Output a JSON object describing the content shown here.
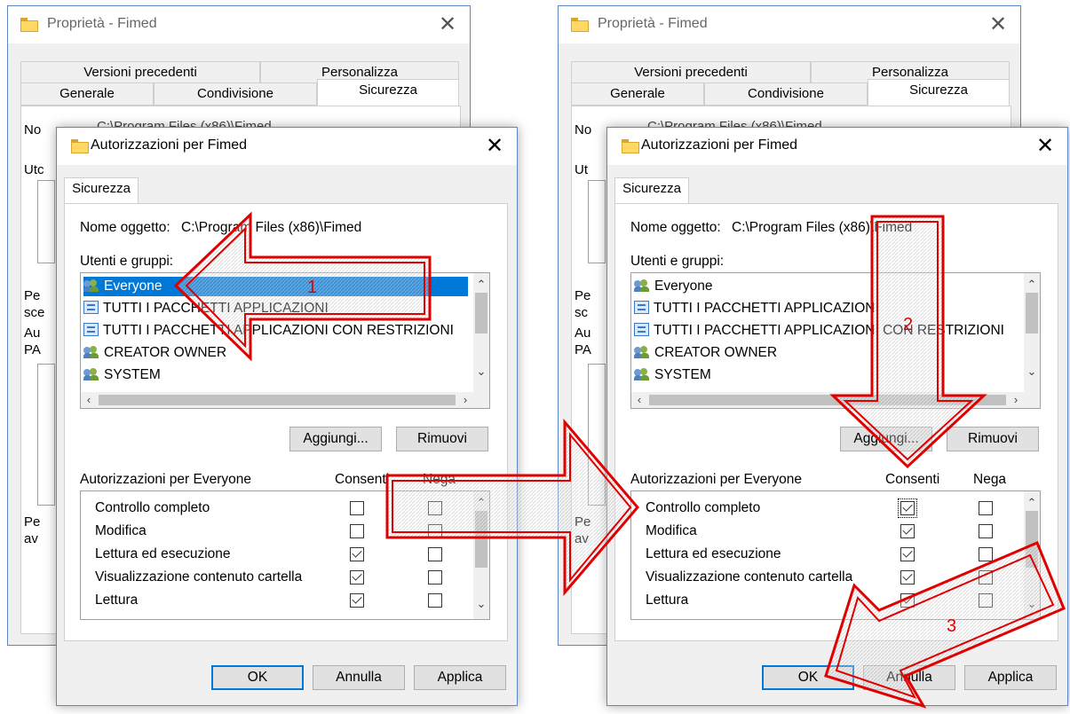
{
  "properties": {
    "title": "Proprietà - Fimed",
    "tabs_row1": [
      "Versioni precedenti",
      "Personalizza"
    ],
    "tabs_row2": [
      "Generale",
      "Condivisione",
      "Sicurezza"
    ],
    "partial_lines": [
      "No",
      "Utc",
      "Pe",
      "sce",
      "Au",
      "PA",
      "Pe",
      "av"
    ],
    "partial_lines_right": [
      "No",
      "Ut",
      "Pe",
      "sc",
      "Au",
      "PA",
      "Pe",
      "av"
    ],
    "partial_header": "C:\\Program Files (x86)\\Fimed"
  },
  "dialog": {
    "title": "Autorizzazioni per Fimed",
    "tab": "Sicurezza",
    "object_label": "Nome oggetto:",
    "object_value": "C:\\Program Files (x86)\\Fimed",
    "groups_label": "Utenti e gruppi:",
    "users": [
      {
        "name": "Everyone",
        "icon": "users-icon",
        "selected": true
      },
      {
        "name": "TUTTI I PACCHETTI APPLICAZIONI",
        "icon": "package-icon",
        "selected": false
      },
      {
        "name": "TUTTI I PACCHETTI APPLICAZIONI CON RESTRIZIONI",
        "icon": "package-icon",
        "selected": false
      },
      {
        "name": "CREATOR OWNER",
        "icon": "users-icon",
        "selected": false
      },
      {
        "name": "SYSTEM",
        "icon": "users-icon",
        "selected": false
      }
    ],
    "add_button": "Aggiungi...",
    "remove_button": "Rimuovi",
    "perm_label": "Autorizzazioni per Everyone",
    "allow_header": "Consenti",
    "deny_header": "Nega",
    "permissions": [
      "Controllo completo",
      "Modifica",
      "Lettura ed esecuzione",
      "Visualizzazione contenuto cartella",
      "Lettura"
    ],
    "left_allow": [
      false,
      false,
      true,
      true,
      true
    ],
    "right_allow": [
      true,
      true,
      true,
      true,
      true
    ],
    "ok": "OK",
    "cancel": "Annulla",
    "apply": "Applica"
  },
  "annotations": {
    "step1": "1",
    "step2": "2",
    "step3": "3",
    "color": "#e00000"
  }
}
